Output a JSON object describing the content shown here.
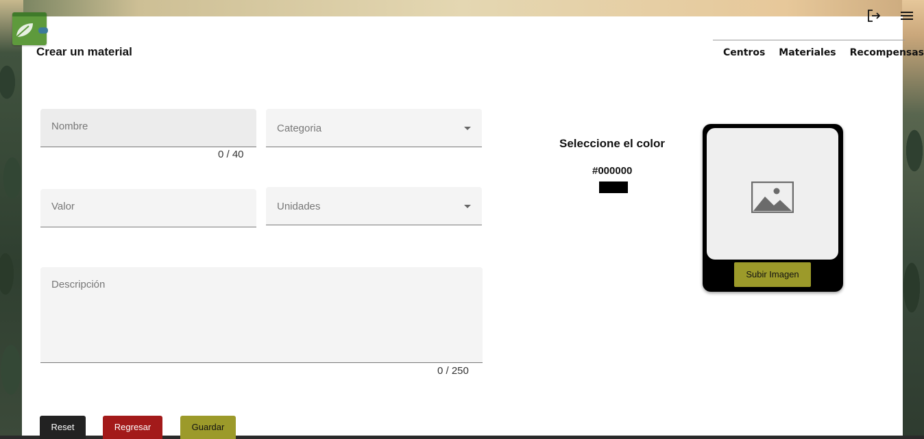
{
  "header": {
    "page_title": "Crear un material",
    "nav": [
      "Centros",
      "Materiales",
      "Recompensas"
    ],
    "icons": [
      "logout-icon",
      "menu-icon"
    ]
  },
  "form": {
    "nombre": {
      "placeholder": "Nombre",
      "counter": "0 / 40"
    },
    "categoria": {
      "placeholder": "Categoria"
    },
    "valor": {
      "placeholder": "Valor"
    },
    "unidades": {
      "placeholder": "Unidades"
    },
    "descripcion": {
      "placeholder": "Descripción",
      "counter": "0 / 250"
    }
  },
  "color_picker": {
    "title": "Seleccione el color",
    "hex": "#000000",
    "swatch_color": "#000000"
  },
  "image_upload": {
    "button_label": "Subir Imagen",
    "icon": "image-placeholder-icon"
  },
  "actions": {
    "reset": {
      "label": "Reset",
      "color": "#222222"
    },
    "regresar": {
      "label": "Regresar",
      "color": "#a31a1a"
    },
    "guardar": {
      "label": "Guardar",
      "color": "#9c9a2a"
    }
  },
  "colors": {
    "accent": "#9c9a2a",
    "brand_green": "#5e9a3c"
  }
}
